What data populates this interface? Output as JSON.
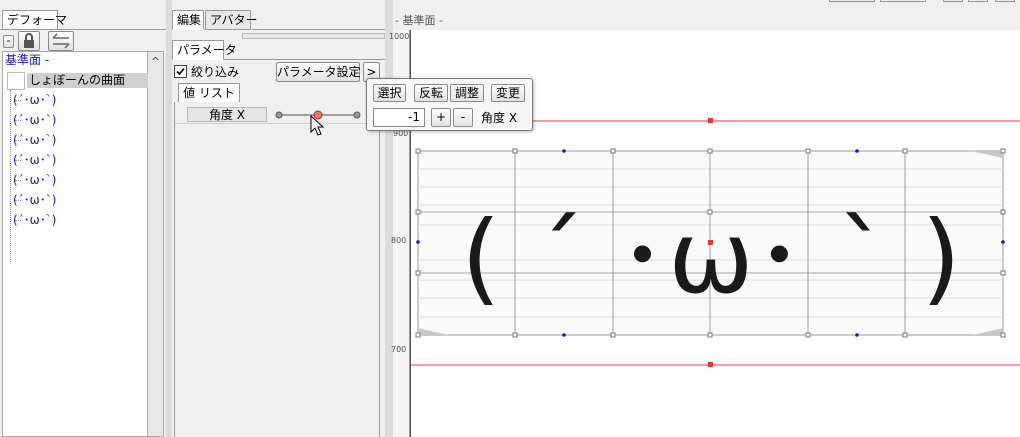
{
  "deformer_panel": {
    "tab_label": "デフォーマ",
    "root_label": "基準面 -",
    "selected_item": "しょぼーんの曲面",
    "items": [
      "(´･ω･`)",
      "(´･ω･`)",
      "(´･ω･`)",
      "(´･ω･`)",
      "(´･ω･`)",
      "(´･ω･`)",
      "(´･ω･`)"
    ],
    "collapse_symbol": "-",
    "scroll_up_symbol": "^"
  },
  "middle_panel": {
    "tabs": [
      "編集",
      "アバター"
    ],
    "param_tab": "パラメータ",
    "filter_label": "絞り込み",
    "filter_checked": true,
    "param_settings_label": "パラメータ設定",
    "expand_symbol": ">",
    "list_tab": "値 リスト",
    "parameter_name": "角度 X",
    "slider_value_fraction": 0.5
  },
  "popup": {
    "buttons": [
      "選択",
      "反転",
      "調整",
      "変更"
    ],
    "value": "-1",
    "plus_label": "+",
    "minus_label": "-",
    "param_label": "角度 X"
  },
  "canvas": {
    "title": "- 基準面 -",
    "ruler_labels": [
      "1000",
      "900",
      "800",
      "700"
    ],
    "face_text": "( ´ ･ω･ ` )",
    "accent_red": "#e53935",
    "handle_blue": "#1a1ab5"
  }
}
